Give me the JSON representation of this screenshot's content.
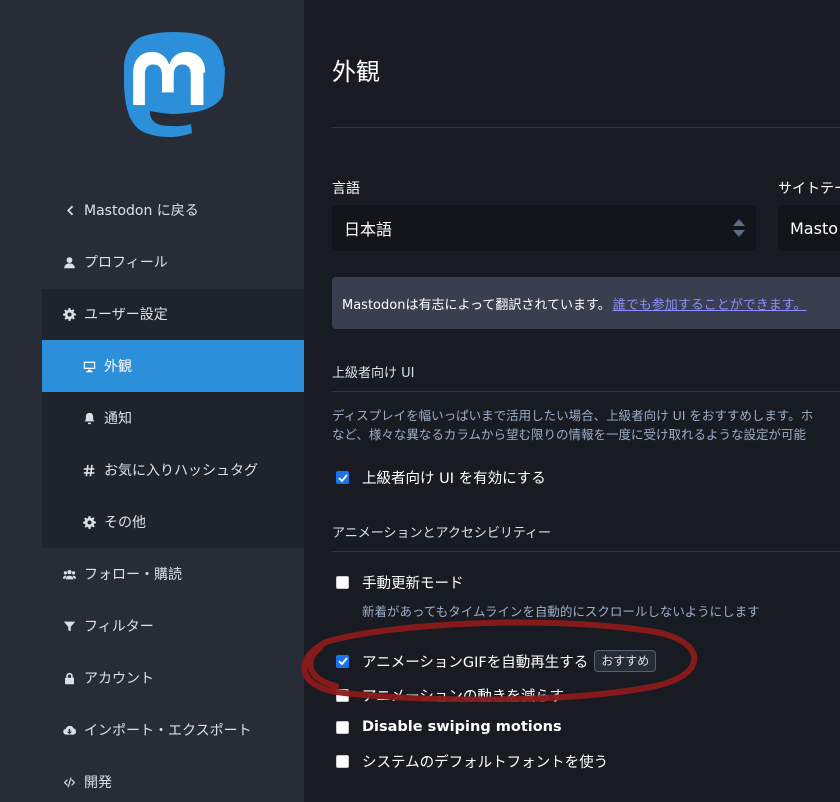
{
  "sidebar": {
    "back": "Mastodon に戻る",
    "items": [
      {
        "label": "プロフィール",
        "icon": "user-icon"
      },
      {
        "label": "ユーザー設定",
        "icon": "gear-icon"
      },
      {
        "label": "外観",
        "icon": "monitor-icon"
      },
      {
        "label": "通知",
        "icon": "bell-icon"
      },
      {
        "label": "お気に入りハッシュタグ",
        "icon": "hashtag-icon"
      },
      {
        "label": "その他",
        "icon": "gear-icon"
      },
      {
        "label": "フォロー・購読",
        "icon": "users-icon"
      },
      {
        "label": "フィルター",
        "icon": "filter-icon"
      },
      {
        "label": "アカウント",
        "icon": "lock-icon"
      },
      {
        "label": "インポート・エクスポート",
        "icon": "cloud-download-icon"
      },
      {
        "label": "開発",
        "icon": "code-icon"
      }
    ],
    "active_item": "外観"
  },
  "main": {
    "title": "外観",
    "language": {
      "label": "言語",
      "value": "日本語"
    },
    "theme": {
      "label": "サイトテー",
      "value": "Masto"
    },
    "notice": {
      "text": "Mastodonは有志によって翻訳されています。",
      "link": "誰でも参加することができます。"
    },
    "advanced": {
      "heading": "上級者向け UI",
      "hint_line1": "ディスプレイを幅いっぱいまで活用したい場合、上級者向け UI をおすすめします。ホ",
      "hint_line2": "など、様々な異なるカラムから望む限りの情報を一度に受け取れるような設定が可能",
      "checkbox_label": "上級者向け UI を有効にする",
      "checked": true
    },
    "animations": {
      "heading": "アニメーションとアクセシビリティー",
      "options": [
        {
          "label": "手動更新モード",
          "hint": "新着があってもタイムラインを自動的にスクロールしないようにします",
          "checked": false
        },
        {
          "label": "アニメーションGIFを自動再生する",
          "badge": "おすすめ",
          "checked": true
        },
        {
          "label": "アニメーションの動きを減らす",
          "checked": false
        },
        {
          "label": "Disable swiping motions",
          "checked": false
        },
        {
          "label": "システムのデフォルトフォントを使う",
          "checked": false
        }
      ]
    }
  },
  "colors": {
    "accent": "#2b90d9",
    "sidebar": "#282c37",
    "background": "#191b22",
    "annotation": "#8b1a1a"
  }
}
